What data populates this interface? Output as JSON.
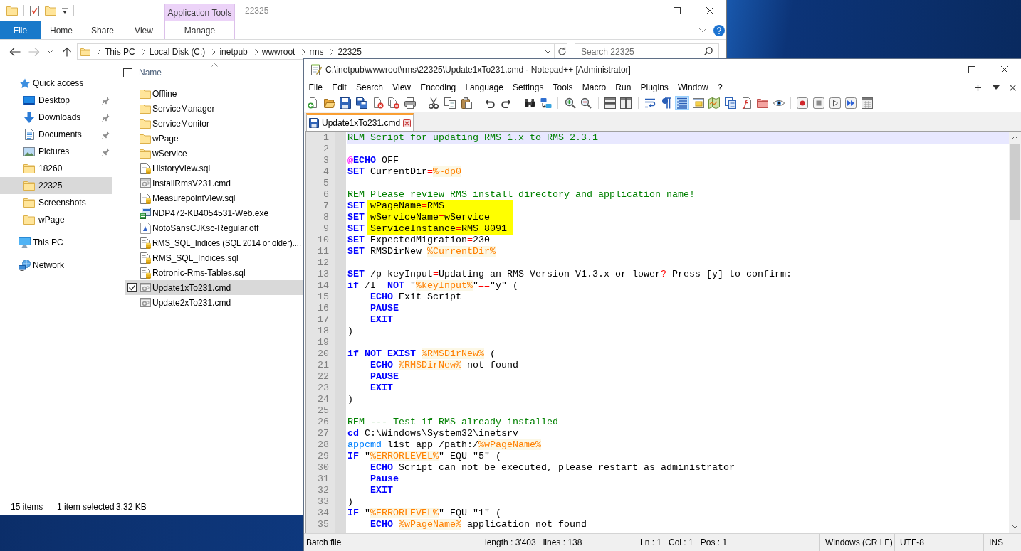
{
  "explorer": {
    "title": "22325",
    "context_group": "Application Tools",
    "ribbon_tabs": [
      {
        "label": "File",
        "kind": "file",
        "selected": false
      },
      {
        "label": "Home",
        "kind": "plain",
        "selected": false
      },
      {
        "label": "Share",
        "kind": "plain",
        "selected": false
      },
      {
        "label": "View",
        "kind": "plain",
        "selected": false
      },
      {
        "label": "Manage",
        "kind": "contextual",
        "selected": false
      }
    ],
    "address": [
      "This PC",
      "Local Disk (C:)",
      "inetpub",
      "wwwroot",
      "rms",
      "22325"
    ],
    "search": {
      "placeholder": "Search 22325"
    },
    "navigation": [
      {
        "label": "Quick access",
        "kind": "star",
        "selected": false,
        "children": [
          {
            "label": "Desktop",
            "kind": "desktop",
            "pinned": true,
            "selected": false
          },
          {
            "label": "Downloads",
            "kind": "downloads",
            "pinned": true,
            "selected": false
          },
          {
            "label": "Documents",
            "kind": "documents",
            "pinned": true,
            "selected": false
          },
          {
            "label": "Pictures",
            "kind": "pictures",
            "pinned": true,
            "selected": false
          },
          {
            "label": "18260",
            "kind": "folder",
            "pinned": false,
            "selected": false
          },
          {
            "label": "22325",
            "kind": "folder",
            "pinned": false,
            "selected": true
          },
          {
            "label": "Screenshots",
            "kind": "folder",
            "pinned": false,
            "selected": false
          },
          {
            "label": "wPage",
            "kind": "folder",
            "pinned": false,
            "selected": false
          }
        ]
      },
      {
        "label": "This PC",
        "kind": "pc",
        "selected": false
      },
      {
        "label": "Network",
        "kind": "network",
        "selected": false
      }
    ],
    "column_header": {
      "label": "Name",
      "checked": false
    },
    "files": [
      {
        "name": "Offline",
        "kind": "folder",
        "selected": false
      },
      {
        "name": "ServiceManager",
        "kind": "folder",
        "selected": false
      },
      {
        "name": "ServiceMonitor",
        "kind": "folder",
        "selected": false
      },
      {
        "name": "wPage",
        "kind": "folder",
        "selected": false
      },
      {
        "name": "wService",
        "kind": "folder",
        "selected": false
      },
      {
        "name": "HistoryView.sql",
        "kind": "sql",
        "selected": false
      },
      {
        "name": "InstallRmsV231.cmd",
        "kind": "cmd",
        "selected": false
      },
      {
        "name": "MeasurepointView.sql",
        "kind": "sql",
        "selected": false
      },
      {
        "name": "NDP472-KB4054531-Web.exe",
        "kind": "exe",
        "selected": false
      },
      {
        "name": "NotoSansCJKsc-Regular.otf",
        "kind": "font",
        "selected": false
      },
      {
        "name": "RMS_SQL_Indices (SQL 2014 or older)....",
        "kind": "sql",
        "selected": false
      },
      {
        "name": "RMS_SQL_Indices.sql",
        "kind": "sql",
        "selected": false
      },
      {
        "name": "Rotronic-Rms-Tables.sql",
        "kind": "sql",
        "selected": false
      },
      {
        "name": "Update1xTo231.cmd",
        "kind": "cmd",
        "selected": true
      },
      {
        "name": "Update2xTo231.cmd",
        "kind": "cmd",
        "selected": false
      }
    ],
    "status_bar": {
      "item_count": "15 items",
      "selection": "1 item selected",
      "selection_size": "3.32 KB"
    }
  },
  "notepad": {
    "title": "C:\\inetpub\\wwwroot\\rms\\22325\\Update1xTo231.cmd - Notepad++ [Administrator]",
    "menu": [
      "File",
      "Edit",
      "Search",
      "View",
      "Encoding",
      "Language",
      "Settings",
      "Tools",
      "Macro",
      "Run",
      "Plugins",
      "Window",
      "?"
    ],
    "toolbar_groups": [
      [
        {
          "on": false
        },
        {
          "on": false
        },
        {
          "on": false
        },
        {
          "on": false
        },
        {
          "on": false
        },
        {
          "on": false
        },
        {
          "on": false
        }
      ],
      [
        {
          "on": false
        },
        {
          "on": false
        },
        {
          "on": false
        }
      ],
      [
        {
          "on": false
        },
        {
          "on": false
        }
      ],
      [
        {
          "on": false
        },
        {
          "on": false
        }
      ],
      [
        {
          "on": false
        },
        {
          "on": false
        }
      ],
      [
        {
          "on": false
        },
        {
          "on": false
        }
      ],
      [
        {
          "on": false
        },
        {
          "on": false
        },
        {
          "on": true
        },
        {
          "on": false
        },
        {
          "on": false
        },
        {
          "on": false
        },
        {
          "on": false
        },
        {
          "on": false
        },
        {
          "on": false
        }
      ],
      [
        {
          "on": false
        },
        {
          "on": false
        },
        {
          "on": false
        },
        {
          "on": false
        },
        {
          "on": false
        }
      ]
    ],
    "tabs": [
      {
        "label": "Update1xTo231.cmd",
        "selected": true
      }
    ],
    "lines": [
      {
        "number": "1",
        "current": true,
        "marked": false,
        "tokens": [
          {
            "kind": "comment",
            "text": "REM Script for updating RMS 1.x to RMS 2.3.1"
          }
        ]
      },
      {
        "number": "2",
        "current": false,
        "marked": false
      },
      {
        "number": "3",
        "current": false,
        "marked": false,
        "tokens": [
          {
            "kind": "at",
            "text": "@"
          },
          {
            "kind": "keyword",
            "text": "ECHO"
          },
          {
            "kind": "text",
            "text": " OFF"
          }
        ]
      },
      {
        "number": "4",
        "current": false,
        "marked": false,
        "tokens": [
          {
            "kind": "keyword",
            "text": "SET"
          },
          {
            "kind": "text",
            "text": " CurrentDir"
          },
          {
            "kind": "operator",
            "text": "="
          },
          {
            "kind": "variable",
            "text": "%~dp0"
          }
        ]
      },
      {
        "number": "5",
        "current": false,
        "marked": false
      },
      {
        "number": "6",
        "current": false,
        "marked": false,
        "tokens": [
          {
            "kind": "comment",
            "text": "REM Please review RMS install directory and application name!"
          }
        ]
      },
      {
        "number": "7",
        "current": false,
        "marked": true,
        "tokens": [
          {
            "kind": "keyword",
            "text": "SET"
          },
          {
            "kind": "text",
            "text": " wPageName"
          },
          {
            "kind": "operator",
            "text": "="
          },
          {
            "kind": "text",
            "text": "RMS"
          }
        ]
      },
      {
        "number": "8",
        "current": false,
        "marked": true,
        "tokens": [
          {
            "kind": "keyword",
            "text": "SET"
          },
          {
            "kind": "text",
            "text": " wServiceName"
          },
          {
            "kind": "operator",
            "text": "="
          },
          {
            "kind": "text",
            "text": "wService"
          }
        ]
      },
      {
        "number": "9",
        "current": false,
        "marked": true,
        "tokens": [
          {
            "kind": "keyword",
            "text": "SET"
          },
          {
            "kind": "text",
            "text": " ServiceInstance"
          },
          {
            "kind": "operator",
            "text": "="
          },
          {
            "kind": "text",
            "text": "RMS_8091"
          }
        ]
      },
      {
        "number": "10",
        "current": false,
        "marked": false,
        "tokens": [
          {
            "kind": "keyword",
            "text": "SET"
          },
          {
            "kind": "text",
            "text": " ExpectedMigration"
          },
          {
            "kind": "operator",
            "text": "="
          },
          {
            "kind": "text",
            "text": "230"
          }
        ]
      },
      {
        "number": "11",
        "current": false,
        "marked": false,
        "tokens": [
          {
            "kind": "keyword",
            "text": "SET"
          },
          {
            "kind": "text",
            "text": " RMSDirNew"
          },
          {
            "kind": "operator",
            "text": "="
          },
          {
            "kind": "variable",
            "text": "%CurrentDir%"
          }
        ]
      },
      {
        "number": "12",
        "current": false,
        "marked": false
      },
      {
        "number": "13",
        "current": false,
        "marked": false,
        "tokens": [
          {
            "kind": "keyword",
            "text": "SET"
          },
          {
            "kind": "text",
            "text": " /p keyInput"
          },
          {
            "kind": "operator",
            "text": "="
          },
          {
            "kind": "text",
            "text": "Updating an RMS Version V1.3.x or lower"
          },
          {
            "kind": "operator",
            "text": "?"
          },
          {
            "kind": "text",
            "text": " Press [y] to confirm:"
          }
        ]
      },
      {
        "number": "14",
        "current": false,
        "marked": false,
        "tokens": [
          {
            "kind": "keyword",
            "text": "if"
          },
          {
            "kind": "text",
            "text": " /I  "
          },
          {
            "kind": "keyword",
            "text": "NOT"
          },
          {
            "kind": "text",
            "text": " \""
          },
          {
            "kind": "variable",
            "text": "%keyInput%"
          },
          {
            "kind": "text",
            "text": "\""
          },
          {
            "kind": "operator",
            "text": "=="
          },
          {
            "kind": "text",
            "text": "\"y\" ("
          }
        ]
      },
      {
        "number": "15",
        "current": false,
        "marked": false,
        "tokens": [
          {
            "kind": "keyword",
            "text": "    ECHO"
          },
          {
            "kind": "text",
            "text": " Exit Script"
          }
        ]
      },
      {
        "number": "16",
        "current": false,
        "marked": false,
        "tokens": [
          {
            "kind": "keyword",
            "text": "    PAUSE"
          }
        ]
      },
      {
        "number": "17",
        "current": false,
        "marked": false,
        "tokens": [
          {
            "kind": "keyword",
            "text": "    EXIT"
          }
        ]
      },
      {
        "number": "18",
        "current": false,
        "marked": false,
        "tokens": [
          {
            "kind": "text",
            "text": ")"
          }
        ]
      },
      {
        "number": "19",
        "current": false,
        "marked": false
      },
      {
        "number": "20",
        "current": false,
        "marked": false,
        "tokens": [
          {
            "kind": "keyword",
            "text": "if"
          },
          {
            "kind": "keyword",
            "text": " NOT"
          },
          {
            "kind": "keyword",
            "text": " EXIST"
          },
          {
            "kind": "variable",
            "text": " %RMSDirNew%"
          },
          {
            "kind": "text",
            "text": " ("
          }
        ]
      },
      {
        "number": "21",
        "current": false,
        "marked": false,
        "tokens": [
          {
            "kind": "keyword",
            "text": "    ECHO"
          },
          {
            "kind": "variable",
            "text": " %RMSDirNew%"
          },
          {
            "kind": "text",
            "text": " not found"
          }
        ]
      },
      {
        "number": "22",
        "current": false,
        "marked": false,
        "tokens": [
          {
            "kind": "keyword",
            "text": "    PAUSE"
          }
        ]
      },
      {
        "number": "23",
        "current": false,
        "marked": false,
        "tokens": [
          {
            "kind": "keyword",
            "text": "    EXIT"
          }
        ]
      },
      {
        "number": "24",
        "current": false,
        "marked": false,
        "tokens": [
          {
            "kind": "text",
            "text": ")"
          }
        ]
      },
      {
        "number": "25",
        "current": false,
        "marked": false
      },
      {
        "number": "26",
        "current": false,
        "marked": false,
        "tokens": [
          {
            "kind": "comment",
            "text": "REM --- Test if RMS already installed"
          }
        ]
      },
      {
        "number": "27",
        "current": false,
        "marked": false,
        "tokens": [
          {
            "kind": "keyword",
            "text": "cd"
          },
          {
            "kind": "text",
            "text": " C:\\Windows\\System32\\inetsrv"
          }
        ]
      },
      {
        "number": "28",
        "current": false,
        "marked": false,
        "tokens": [
          {
            "kind": "command",
            "text": "appcmd"
          },
          {
            "kind": "text",
            "text": " list app /path:/"
          },
          {
            "kind": "variable",
            "text": "%wPageName%"
          }
        ]
      },
      {
        "number": "29",
        "current": false,
        "marked": false,
        "tokens": [
          {
            "kind": "keyword",
            "text": "IF"
          },
          {
            "kind": "text",
            "text": " \""
          },
          {
            "kind": "variable",
            "text": "%ERRORLEVEL%"
          },
          {
            "kind": "text",
            "text": "\" EQU \"5\" ("
          }
        ]
      },
      {
        "number": "30",
        "current": false,
        "marked": false,
        "tokens": [
          {
            "kind": "keyword",
            "text": "    ECHO"
          },
          {
            "kind": "text",
            "text": " Script can not be executed, please restart as administrator"
          }
        ]
      },
      {
        "number": "31",
        "current": false,
        "marked": false,
        "tokens": [
          {
            "kind": "keyword",
            "text": "    Pause"
          }
        ]
      },
      {
        "number": "32",
        "current": false,
        "marked": false,
        "tokens": [
          {
            "kind": "keyword",
            "text": "    EXIT"
          }
        ]
      },
      {
        "number": "33",
        "current": false,
        "marked": false,
        "tokens": [
          {
            "kind": "text",
            "text": ")"
          }
        ]
      },
      {
        "number": "34",
        "current": false,
        "marked": false,
        "tokens": [
          {
            "kind": "keyword",
            "text": "IF"
          },
          {
            "kind": "text",
            "text": " \""
          },
          {
            "kind": "variable",
            "text": "%ERRORLEVEL%"
          },
          {
            "kind": "text",
            "text": "\" EQU \"1\" ("
          }
        ]
      },
      {
        "number": "35",
        "current": false,
        "marked": false,
        "tokens": [
          {
            "kind": "keyword",
            "text": "    ECHO"
          },
          {
            "kind": "variable",
            "text": " %wPageName%"
          },
          {
            "kind": "text",
            "text": " application not found"
          }
        ]
      }
    ],
    "status_bar": {
      "file_type": "Batch file",
      "length": "length : 3'403",
      "lines": "lines : 138",
      "line": "Ln : 1",
      "column": "Col : 1",
      "position": "Pos : 1",
      "eol": "Windows (CR LF)",
      "encoding": "UTF-8",
      "mode": "INS"
    }
  }
}
